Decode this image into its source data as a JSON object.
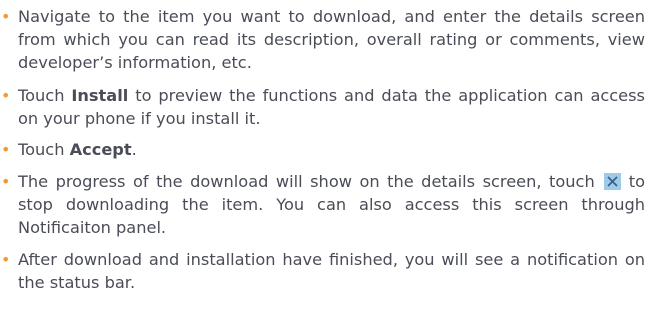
{
  "bullet_char": "•",
  "colors": {
    "bullet": "#f29b36",
    "text": "#4a4d57",
    "icon_bg": "#9ecbe8",
    "icon_x": "#3a5f8a"
  },
  "icons": {
    "stop_icon": "close-x-icon"
  },
  "items": [
    {
      "text": "Navigate to the item you want to download, and enter the details screen from which you can read its description, overall rating or comments, view developer’s information, etc."
    },
    {
      "prefix": "Touch ",
      "bold": "Install",
      "suffix": " to preview the functions and data the application can access on your phone if you install it."
    },
    {
      "prefix": "Touch ",
      "bold": "Accept",
      "suffix": "."
    },
    {
      "before_icon": "The progress of the download will show on the details screen, touch",
      "after_icon": "to stop downloading the item. You can also access this screen through Notificaiton panel."
    },
    {
      "text": "After download and installation have finished, you will see a notification on the status bar."
    }
  ]
}
